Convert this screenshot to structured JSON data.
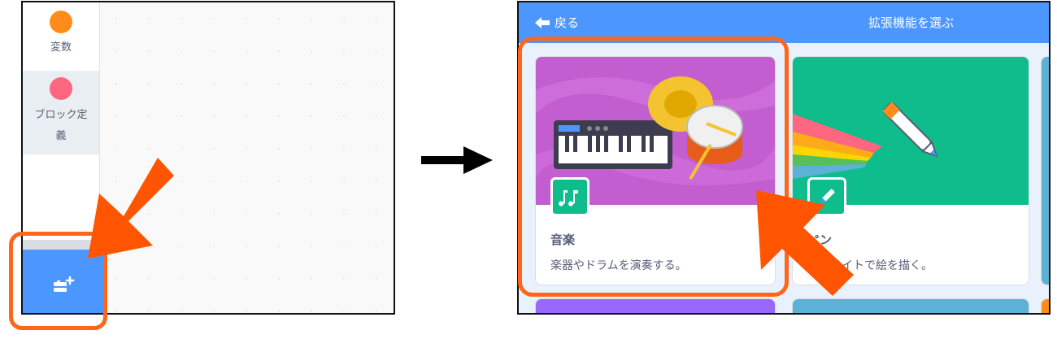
{
  "sidebar": {
    "categories": [
      {
        "label": "変数",
        "color": "#ff8c1a"
      },
      {
        "label_line1": "ブロック定",
        "label_line2": "義",
        "color": "#ff6680"
      }
    ],
    "extension_button_icon": "add-extension-icon"
  },
  "modal": {
    "back_label": "戻る",
    "title": "拡張機能を選ぶ"
  },
  "extensions": [
    {
      "title": "音楽",
      "description": "楽器やドラムを演奏する。",
      "icon": "music-notes-icon",
      "color": "#c25ecf"
    },
    {
      "title": "ペン",
      "description": "スプライトで絵を描く。",
      "icon": "pen-icon",
      "color": "#0fbd8c"
    }
  ],
  "colors": {
    "accent": "#4c97ff",
    "highlight": "#ff661a"
  }
}
